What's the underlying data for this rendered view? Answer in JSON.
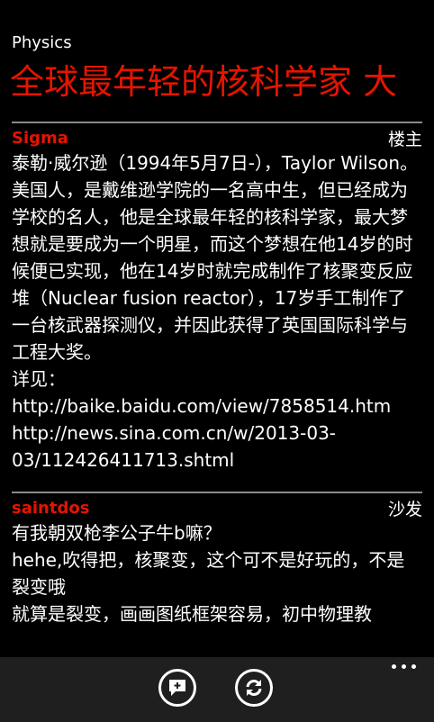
{
  "app": {
    "title": "Physics"
  },
  "thread": {
    "title": "全球最年轻的核科学家 大"
  },
  "posts": [
    {
      "author": "Sigma",
      "floor": "楼主",
      "lines": [
        "泰勒·威尔逊（1994年5月7日-），Taylor Wilson。美国人，是戴维逊学院的一名高中生，但已经成为学校的名人，他是全球最年轻的核科学家，最大梦想就是要成为一个明星，而这个梦想在他14岁的时候便已实现，他在14岁时就完成制作了核聚变反应堆（Nuclear fusion reactor），17岁手工制作了一台核武器探测仪，并因此获得了英国国际科学与工程大奖。",
        "详见：http://baike.baidu.com/view/7858514.htm",
        "http://news.sina.com.cn/w/2013-03-03/112426411713.shtml"
      ]
    },
    {
      "author": "saintdos",
      "floor": "沙发",
      "lines": [
        "有我朝双枪李公子牛b嘛？",
        "hehe,吹得把，核聚变，这个可不是好玩的，不是裂变哦",
        "就算是裂变，画画图纸框架容易，初中物理教"
      ]
    }
  ],
  "appbar": {
    "reply_icon": "reply-icon",
    "refresh_icon": "refresh-icon",
    "more_icon": "more-icon"
  }
}
